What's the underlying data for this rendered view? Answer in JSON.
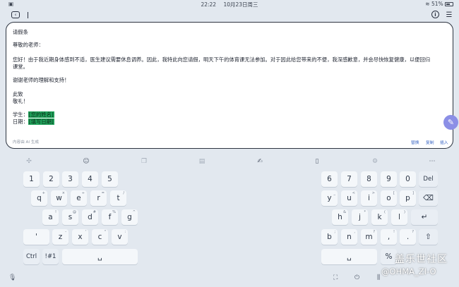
{
  "status": {
    "time": "22:22",
    "date": "10月23日周三",
    "battery": "51%"
  },
  "document": {
    "title": "请假条",
    "greeting": "尊敬的老师：",
    "body_line1": "您好！由于我近期身体感到不适，医生建议需要休息调养。因此，我特此向您请假，明天下午的体育课无法参加。对于因此给您带来的不便，我深感歉意，并会尽快恢复健康，以便回归",
    "body_line2": "课堂。",
    "thanks": "谢谢老师的理解和支持！",
    "closing1": "此致",
    "closing2": "敬礼！",
    "student_label": "学生：",
    "student_value": "[您的姓名]",
    "date_label": "日期：",
    "date_value": "[填写日期]"
  },
  "card_footer": {
    "note": "内容由 AI 生成",
    "replace": "替换",
    "copy": "复制",
    "insert": "插入"
  },
  "keyboard": {
    "row1_left": [
      "1",
      "2",
      "3",
      "4",
      "5"
    ],
    "row1_right": [
      "6",
      "7",
      "8",
      "9",
      "0",
      "Del"
    ],
    "row2_left": [
      {
        "k": "q",
        "s": "+"
      },
      {
        "k": "w",
        "s": "×"
      },
      {
        "k": "e",
        "s": "÷"
      },
      {
        "k": "r",
        "s": "="
      },
      {
        "k": "t",
        "s": "/"
      }
    ],
    "row2_right": [
      {
        "k": "y",
        "s": "_"
      },
      {
        "k": "u",
        "s": "<"
      },
      {
        "k": "i",
        "s": ">"
      },
      {
        "k": "o",
        "s": "["
      },
      {
        "k": "p",
        "s": "]"
      }
    ],
    "row3_left": [
      {
        "k": "a",
        "s": "!"
      },
      {
        "k": "s",
        "s": "@"
      },
      {
        "k": "d",
        "s": "#"
      },
      {
        "k": "f",
        "s": "%"
      },
      {
        "k": "g",
        "s": "^"
      }
    ],
    "row3_right": [
      {
        "k": "h",
        "s": "&"
      },
      {
        "k": "j",
        "s": "*"
      },
      {
        "k": "k",
        "s": "("
      },
      {
        "k": "l",
        "s": ")"
      }
    ],
    "row4_left": [
      {
        "k": "'",
        "s": ""
      },
      {
        "k": "z",
        "s": "-"
      },
      {
        "k": "x",
        "s": "'"
      },
      {
        "k": "c",
        "s": "\""
      },
      {
        "k": "v",
        "s": ":"
      }
    ],
    "row4_right": [
      {
        "k": "b",
        "s": ";"
      },
      {
        "k": "n",
        "s": ","
      },
      {
        "k": "m",
        "s": "?"
      },
      {
        "k": ",",
        "s": "!"
      },
      {
        "k": ".",
        "s": "?"
      }
    ],
    "ctrl": "Ctrl",
    "sym": "!#1",
    "percent_key": "%"
  },
  "watermark": {
    "line1": "盖乐世社区",
    "line2": "@OHMA_ZI-O"
  }
}
